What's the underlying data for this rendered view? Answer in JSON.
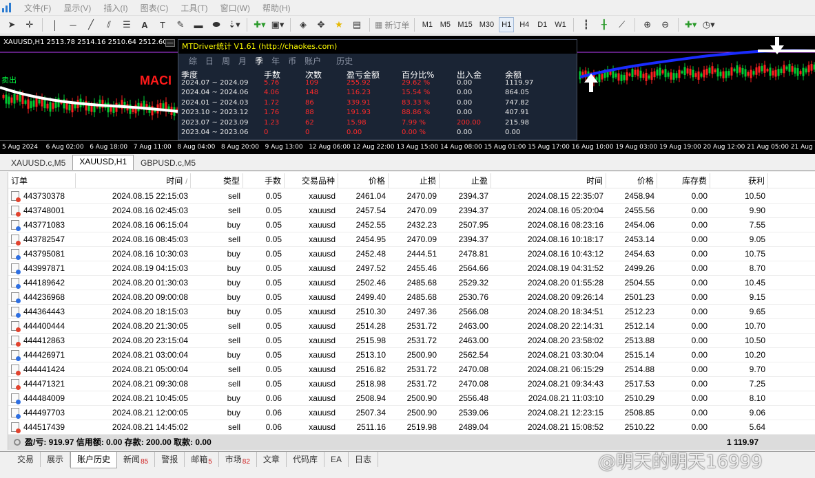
{
  "menubar": {
    "items": [
      "文件(F)",
      "显示(V)",
      "插入(I)",
      "图表(C)",
      "工具(T)",
      "窗口(W)",
      "帮助(H)"
    ]
  },
  "toolbar": {
    "new_order_label": "新订单",
    "timeframes": [
      "M1",
      "M5",
      "M15",
      "M30",
      "H1",
      "H4",
      "D1",
      "W1"
    ],
    "active_timeframe": "H1"
  },
  "chart": {
    "title": "XAUUSD,H1  2513.78 2514.16 2510.64 2512.60",
    "left_red_text": "MACI",
    "left_green_text": "卖出",
    "time_labels": [
      "5 Aug 2024",
      "6 Aug 02:00",
      "6 Aug 18:00",
      "7 Aug 11:00",
      "8 Aug 04:00",
      "8 Aug 20:00",
      "9 Aug 13:00",
      "12 Aug 06:00",
      "12 Aug 22:00",
      "13 Aug 15:00",
      "14 Aug 08:00",
      "15 Aug 01:00",
      "15 Aug 17:00",
      "16 Aug 10:00",
      "19 Aug 03:00",
      "19 Aug 19:00",
      "20 Aug 12:00",
      "21 Aug 05:00",
      "21 Aug"
    ],
    "colors": {
      "background": "#000000",
      "ma_white": "#ffffff",
      "ma_blue": "#1a2cff",
      "bull": "#00cc33",
      "bear": "#ff2020",
      "level_line": "#c040ff"
    }
  },
  "stats_panel": {
    "title": "MTDriver统计 V1.61  (http://chaokes.com)",
    "tabs": [
      "综",
      "日",
      "周",
      "月",
      "季",
      "年",
      "币",
      "账户",
      "历史"
    ],
    "active_tab": "季",
    "headers": [
      "季度",
      "手数",
      "次数",
      "盈亏金额",
      "百分比%",
      "出入金",
      "余额"
    ],
    "rows": [
      [
        "2024.07 ~ 2024.09",
        "5.76",
        "109",
        "255.92",
        "29.62 %",
        "0.00",
        "1119.97"
      ],
      [
        "2024.04 ~ 2024.06",
        "4.06",
        "148",
        "116.23",
        "15.54 %",
        "0.00",
        "864.05"
      ],
      [
        "2024.01 ~ 2024.03",
        "1.72",
        "86",
        "339.91",
        "83.33 %",
        "0.00",
        "747.82"
      ],
      [
        "2023.10 ~ 2023.12",
        "1.76",
        "88",
        "191.93",
        "88.86 %",
        "0.00",
        "407.91"
      ],
      [
        "2023.07 ~ 2023.09",
        "1.23",
        "62",
        "15.98",
        "7.99 %",
        "200.00",
        "215.98"
      ],
      [
        "2023.04 ~ 2023.06",
        "0",
        "0",
        "0.00",
        "0.00 %",
        "0.00",
        "0.00"
      ]
    ]
  },
  "chart_tabs": {
    "items": [
      "XAUUSD.c,M5",
      "XAUUSD,H1",
      "GBPUSD.c,M5"
    ],
    "active": "XAUUSD,H1"
  },
  "history": {
    "columns": [
      "订单",
      "时间",
      "类型",
      "手数",
      "交易品种",
      "价格",
      "止损",
      "止盈",
      "时间",
      "价格",
      "库存费",
      "获利"
    ],
    "sort_mark": "/",
    "rows": [
      [
        "443730378",
        "2024.08.15 22:15:03",
        "sell",
        "0.05",
        "xauusd",
        "2461.04",
        "2470.09",
        "2394.37",
        "2024.08.15 22:35:07",
        "2458.94",
        "0.00",
        "10.50"
      ],
      [
        "443748001",
        "2024.08.16 02:45:03",
        "sell",
        "0.05",
        "xauusd",
        "2457.54",
        "2470.09",
        "2394.37",
        "2024.08.16 05:20:04",
        "2455.56",
        "0.00",
        "9.90"
      ],
      [
        "443771083",
        "2024.08.16 06:15:04",
        "buy",
        "0.05",
        "xauusd",
        "2452.55",
        "2432.23",
        "2507.95",
        "2024.08.16 08:23:16",
        "2454.06",
        "0.00",
        "7.55"
      ],
      [
        "443782547",
        "2024.08.16 08:45:03",
        "sell",
        "0.05",
        "xauusd",
        "2454.95",
        "2470.09",
        "2394.37",
        "2024.08.16 10:18:17",
        "2453.14",
        "0.00",
        "9.05"
      ],
      [
        "443795081",
        "2024.08.16 10:30:03",
        "buy",
        "0.05",
        "xauusd",
        "2452.48",
        "2444.51",
        "2478.81",
        "2024.08.16 10:43:12",
        "2454.63",
        "0.00",
        "10.75"
      ],
      [
        "443997871",
        "2024.08.19 04:15:03",
        "buy",
        "0.05",
        "xauusd",
        "2497.52",
        "2455.46",
        "2564.66",
        "2024.08.19 04:31:52",
        "2499.26",
        "0.00",
        "8.70"
      ],
      [
        "444189642",
        "2024.08.20 01:30:03",
        "buy",
        "0.05",
        "xauusd",
        "2502.46",
        "2485.68",
        "2529.32",
        "2024.08.20 01:55:28",
        "2504.55",
        "0.00",
        "10.45"
      ],
      [
        "444236968",
        "2024.08.20 09:00:08",
        "buy",
        "0.05",
        "xauusd",
        "2499.40",
        "2485.68",
        "2530.76",
        "2024.08.20 09:26:14",
        "2501.23",
        "0.00",
        "9.15"
      ],
      [
        "444364443",
        "2024.08.20 18:15:03",
        "buy",
        "0.05",
        "xauusd",
        "2510.30",
        "2497.36",
        "2566.08",
        "2024.08.20 18:34:51",
        "2512.23",
        "0.00",
        "9.65"
      ],
      [
        "444400444",
        "2024.08.20 21:30:05",
        "sell",
        "0.05",
        "xauusd",
        "2514.28",
        "2531.72",
        "2463.00",
        "2024.08.20 22:14:31",
        "2512.14",
        "0.00",
        "10.70"
      ],
      [
        "444412863",
        "2024.08.20 23:15:04",
        "sell",
        "0.05",
        "xauusd",
        "2515.98",
        "2531.72",
        "2463.00",
        "2024.08.20 23:58:02",
        "2513.88",
        "0.00",
        "10.50"
      ],
      [
        "444426971",
        "2024.08.21 03:00:04",
        "buy",
        "0.05",
        "xauusd",
        "2513.10",
        "2500.90",
        "2562.54",
        "2024.08.21 03:30:04",
        "2515.14",
        "0.00",
        "10.20"
      ],
      [
        "444441424",
        "2024.08.21 05:00:04",
        "sell",
        "0.05",
        "xauusd",
        "2516.82",
        "2531.72",
        "2470.08",
        "2024.08.21 06:15:29",
        "2514.88",
        "0.00",
        "9.70"
      ],
      [
        "444471321",
        "2024.08.21 09:30:08",
        "sell",
        "0.05",
        "xauusd",
        "2518.98",
        "2531.72",
        "2470.08",
        "2024.08.21 09:34:43",
        "2517.53",
        "0.00",
        "7.25"
      ],
      [
        "444484009",
        "2024.08.21 10:45:05",
        "buy",
        "0.06",
        "xauusd",
        "2508.94",
        "2500.90",
        "2556.48",
        "2024.08.21 11:03:10",
        "2510.29",
        "0.00",
        "8.10"
      ],
      [
        "444497703",
        "2024.08.21 12:00:05",
        "buy",
        "0.06",
        "xauusd",
        "2507.34",
        "2500.90",
        "2539.06",
        "2024.08.21 12:23:15",
        "2508.85",
        "0.00",
        "9.06"
      ],
      [
        "444517439",
        "2024.08.21 14:45:02",
        "sell",
        "0.06",
        "xauusd",
        "2511.16",
        "2519.98",
        "2489.04",
        "2024.08.21 15:08:52",
        "2510.22",
        "0.00",
        "5.64"
      ]
    ],
    "summary_left": "盈/亏: 919.97  信用额: 0.00  存款: 200.00  取款: 0.00",
    "summary_right": "1 119.97"
  },
  "bottom_tabs": {
    "items": [
      {
        "label": "交易",
        "badge": ""
      },
      {
        "label": "展示",
        "badge": ""
      },
      {
        "label": "账户历史",
        "badge": ""
      },
      {
        "label": "新闻",
        "badge": "85"
      },
      {
        "label": "警报",
        "badge": ""
      },
      {
        "label": "邮箱",
        "badge": "5"
      },
      {
        "label": "市场",
        "badge": "82"
      },
      {
        "label": "文章",
        "badge": ""
      },
      {
        "label": "代码库",
        "badge": ""
      },
      {
        "label": "EA",
        "badge": ""
      },
      {
        "label": "日志",
        "badge": ""
      }
    ],
    "active": "账户历史"
  },
  "watermark": "@明天的明天16999"
}
